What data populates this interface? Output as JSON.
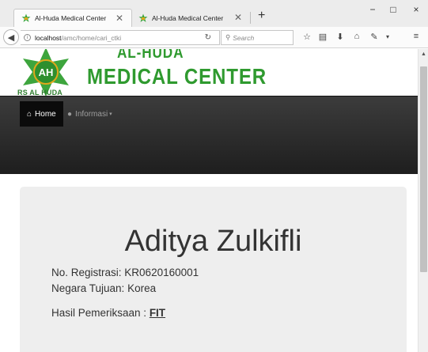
{
  "browser": {
    "tabs": [
      {
        "title": "Al-Huda Medical Center",
        "active": true
      },
      {
        "title": "Al-Huda Medical Center",
        "active": false
      }
    ],
    "new_tab": "+",
    "window_controls": {
      "minimize": "−",
      "maximize": "□",
      "close": "×"
    },
    "url": {
      "host": "localhost",
      "path": "/amc/home/cari_ctki"
    },
    "search_placeholder": "Search"
  },
  "site": {
    "brand_line1": "AL-HUDA",
    "brand_line2": "MEDICAL CENTER",
    "logo_subtext": "RS AL HUDA",
    "logo_letters": "AH",
    "brand_color": "#2f9a2f",
    "nav": {
      "home": "Home",
      "informasi": "Informasi"
    }
  },
  "result": {
    "name": "Aditya Zulkifli",
    "registration_label": "No. Registrasi:",
    "registration_value": "KR0620160001",
    "destination_label": "Negara Tujuan:",
    "destination_value": "Korea",
    "exam_label": "Hasil Pemeriksaan :",
    "exam_value": "FIT"
  }
}
